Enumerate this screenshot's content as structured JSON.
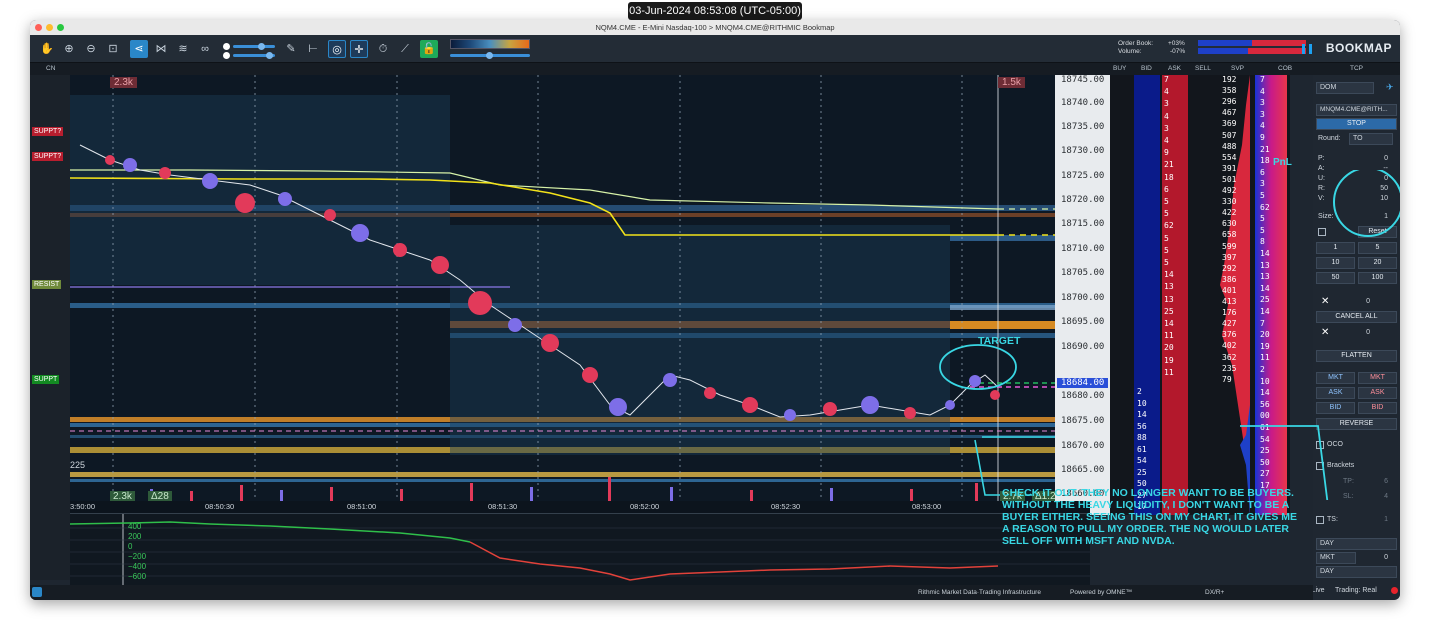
{
  "timestamp_banner": "03-Jun-2024 08:53:08 (UTC-05:00)",
  "window": {
    "title": "NQM4.CME - E-Mini Nasdaq-100 > MNQM4.CME@RITHMIC      Bookmap"
  },
  "toolbar": {
    "order_book_label": "Order Book:",
    "order_book_value": "+03%",
    "volume_label": "Volume:",
    "volume_value": "-07%",
    "brand": "BOOKMAP"
  },
  "columns": {
    "cn": "CN",
    "buy": "BUY",
    "bid": "BID",
    "ask": "ASK",
    "sell": "SELL",
    "svp": "SVP",
    "cob": "COB",
    "tcp": "TCP"
  },
  "heatmap": {
    "left_labels": [
      {
        "text": "SUPPT?",
        "color": "#d8283d"
      },
      {
        "text": "SUPPT?",
        "color": "#d8283d"
      },
      {
        "text": "RESIST",
        "color": "#8fa84a"
      },
      {
        "text": "SUPPT",
        "color": "#1eaa2a"
      }
    ],
    "top_left_volume": "2.3k",
    "top_right_volume": "1.5k",
    "bottom_left_volume": "2.3k",
    "bottom_delta": "Δ28",
    "bottom_right_volume": "2.7k",
    "bottom_right_delta": "Δ1.2k",
    "bottom_left_count": "225",
    "current_price_marker": "18684.00",
    "level_size": "2"
  },
  "price_scale": [
    "18745.00",
    "18740.00",
    "18735.00",
    "18730.00",
    "18725.00",
    "18720.00",
    "18715.00",
    "18710.00",
    "18705.00",
    "18700.00",
    "18695.00",
    "18690.00",
    "18685.00",
    "18680.00",
    "18675.00",
    "18670.00",
    "18665.00",
    "18660.00"
  ],
  "time_axis": [
    "3:50:00",
    "08:50:30",
    "08:51:00",
    "08:51:30",
    "08:52:00",
    "08:52:30",
    "08:53:00"
  ],
  "indicator_axis": [
    "400",
    "200",
    "0",
    "−200",
    "−400",
    "−600"
  ],
  "dom": {
    "ask_sizes": [
      "7",
      "4",
      "3",
      "4",
      "3",
      "4",
      "9",
      "21",
      "18",
      "6",
      "5",
      "5",
      "62",
      "5",
      "5",
      "5",
      "14",
      "13",
      "13",
      "25",
      "14",
      "11",
      "20",
      "19",
      "11"
    ],
    "bid_sizes": [
      "2",
      "10",
      "14",
      "56",
      "88",
      "61",
      "54",
      "25",
      "50",
      "27",
      "17"
    ],
    "svp_values": [
      "192",
      "358",
      "296",
      "467",
      "369",
      "507",
      "488",
      "554",
      "391",
      "501",
      "492",
      "330",
      "422",
      "630",
      "658",
      "599",
      "397",
      "292",
      "386",
      "401",
      "413",
      "176",
      "427",
      "376",
      "402",
      "362",
      "235",
      "79"
    ],
    "cob_values": [
      "7",
      "4",
      "3",
      "3",
      "4",
      "9",
      "21",
      "18",
      "6",
      "3",
      "5",
      "62",
      "5",
      "5",
      "8",
      "14",
      "13",
      "13",
      "14",
      "25",
      "14",
      "7",
      "20",
      "19",
      "11",
      "2",
      "10",
      "14",
      "56",
      "00",
      "61",
      "54",
      "25",
      "50",
      "27",
      "17"
    ]
  },
  "tcp": {
    "dom_select": "DOM",
    "account_select": "MNQM4.CME@RITH...",
    "stop_button": "STOP",
    "round_label": "Round:",
    "round_value": "TO",
    "p_label": "P:",
    "p_value": "0",
    "a_label": "A:",
    "a_value": "--",
    "u_label": "U:",
    "u_value": "0",
    "r_label": "R:",
    "r_value": "50",
    "v_label": "V:",
    "v_value": "10",
    "size_label": "Size:",
    "size_value": "1",
    "reset": "Reset",
    "size_buttons": [
      "1",
      "5",
      "10",
      "20",
      "50",
      "100"
    ],
    "x_count_1": "0",
    "cancel_all": "CANCEL ALL",
    "x_count_2": "0",
    "flatten": "FLATTEN",
    "mkt_left": "MKT",
    "mkt_right": "MKT",
    "ask_left": "ASK",
    "ask_right": "ASK",
    "bid_left": "BID",
    "bid_right": "BID",
    "reverse": "REVERSE",
    "oco": "OCO",
    "brackets": "Brackets",
    "tp_label": "TP:",
    "tp_value": "6",
    "sl_label": "SL:",
    "sl_value": "4",
    "ts_label": "TS:",
    "ts_value": "1",
    "day_1": "DAY",
    "mkt_select": "MKT",
    "mkt_select_value": "0",
    "day_2": "DAY",
    "data_status": "Data: Live",
    "trading_status": "Trading: Real"
  },
  "footer": {
    "rithmic": "Rithmic  Market Data·Trading Infrastructure",
    "omne": "Powered by OMNE™",
    "dx": "DX/R+"
  },
  "annotations": {
    "target": "TARGET",
    "pnl": "PnL",
    "note": "CHECK IT OUT.  THEY NO LONGER WANT TO BE BUYERS. WITHOUT THE HEAVY LIQUIDITY, I DON'T WANT TO BE A BUYER EITHER.  SEEING THIS ON MY CHART, IT GIVES ME A REASON TO PULL MY ORDER. THE NQ WOULD LATER SELL OFF WITH MSFT AND NVDA."
  },
  "colors": {
    "accent_cyan": "#39d7e4",
    "bid_blue": "#0a1b8a",
    "ask_red": "#b3182c",
    "yellow_line": "#f2e21a"
  }
}
